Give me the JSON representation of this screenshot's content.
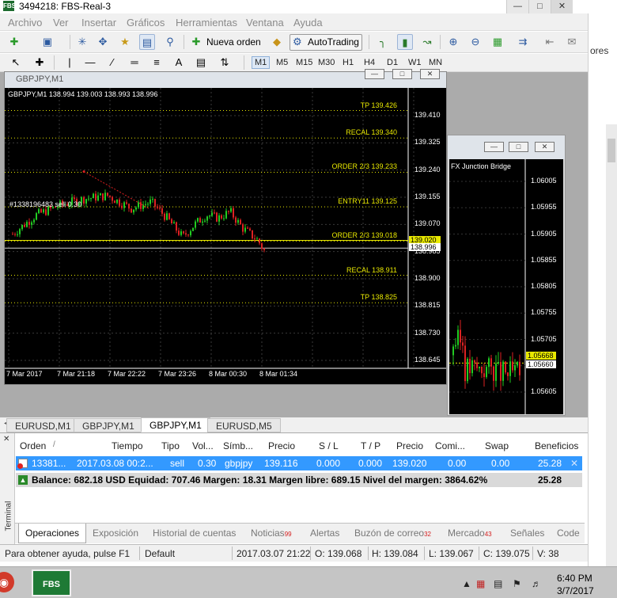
{
  "window": {
    "title": "3494218: FBS-Real-3",
    "app_icon": "FBS"
  },
  "menu": [
    "Archivo",
    "Ver",
    "Insertar",
    "Gráficos",
    "Herramientas",
    "Ventana",
    "Ayuda"
  ],
  "toolbar": {
    "new_order_label": "Nueva orden",
    "autotrading_label": "AutoTrading"
  },
  "timeframes": [
    "M1",
    "M5",
    "M15",
    "M30",
    "H1",
    "H4",
    "D1",
    "W1",
    "MN"
  ],
  "active_timeframe": "M1",
  "chart_main": {
    "window_title": "GBPJPY,M1",
    "header": "GBPJPY,M1  138.994 139.003 138.993 138.996",
    "price_ticks": [
      "139.410",
      "139.325",
      "139.240",
      "139.155",
      "139.070",
      "138.985",
      "138.900",
      "138.815",
      "138.730",
      "138.645"
    ],
    "time_ticks": [
      "7 Mar 2017",
      "7 Mar 21:18",
      "7 Mar 22:22",
      "7 Mar 23:26",
      "8 Mar 00:30",
      "8 Mar 01:34"
    ],
    "current_price": "138.996",
    "entry_marker": "139.020",
    "order_label": "#1338196483 sell 0.30",
    "levels": [
      {
        "label": "TP",
        "price": "139.426"
      },
      {
        "label": "RECAL",
        "price": "139.340"
      },
      {
        "label": "ORDER 2/3",
        "price": "139.233"
      },
      {
        "label": "ENTRY11",
        "price": "139.125"
      },
      {
        "label": "ORDER 2/3",
        "price": "139.018"
      },
      {
        "label": "RECAL",
        "price": "138.911"
      },
      {
        "label": "TP",
        "price": "138.825"
      }
    ]
  },
  "chart_second": {
    "label": "FX Junction Bridge",
    "price_ticks": [
      "1.06005",
      "1.05955",
      "1.05905",
      "1.05855",
      "1.05805",
      "1.05755",
      "1.05705",
      "1.05655",
      "1.05605"
    ],
    "current_price": "1.05660",
    "marker": "1.05668"
  },
  "right_strip": {
    "text": "ores"
  },
  "chart_tabs": [
    "EURUSD,M1",
    "GBPJPY,M1",
    "GBPJPY,M1",
    "EURUSD,M5"
  ],
  "active_chart_tab": 2,
  "terminal": {
    "side_label": "Terminal",
    "columns": [
      "Orden",
      "Tiempo",
      "Tipo",
      "Vol...",
      "Símb...",
      "Precio",
      "S / L",
      "T / P",
      "Precio",
      "Comi...",
      "Swap",
      "Beneficios"
    ],
    "order_row": [
      "13381...",
      "2017.03.08 00:2...",
      "sell",
      "0.30",
      "gbpjpy",
      "139.116",
      "0.000",
      "0.000",
      "139.020",
      "0.00",
      "0.00",
      "25.28"
    ],
    "balance_row": "Balance: 682.18 USD  Equidad: 707.46  Margen: 18.31  Margen libre: 689.15  Nivel del margen: 3864.62%",
    "balance_profit": "25.28",
    "tabs": [
      {
        "label": "Operaciones",
        "badge": ""
      },
      {
        "label": "Exposición",
        "badge": ""
      },
      {
        "label": "Historial de cuentas",
        "badge": ""
      },
      {
        "label": "Noticias",
        "badge": "99"
      },
      {
        "label": "Alertas",
        "badge": ""
      },
      {
        "label": "Buzón de correo",
        "badge": "32"
      },
      {
        "label": "Mercado",
        "badge": "43"
      },
      {
        "label": "Señales",
        "badge": ""
      },
      {
        "label": "Code",
        "badge": ""
      }
    ]
  },
  "statusbar": {
    "help": "Para obtener ayuda, pulse F1",
    "profile": "Default",
    "datetime": "2017.03.07 21:22",
    "open": "O: 139.068",
    "high": "H: 139.084",
    "low": "L: 139.067",
    "close": "C: 139.075",
    "volume": "V: 38"
  },
  "taskbar": {
    "app_label": "FBS",
    "time": "6:40 PM",
    "date": "3/7/2017"
  },
  "colors": {
    "chart_bg": "#000000",
    "level_yellow": "#e8e800",
    "bull": "#22cc22",
    "bear": "#dd2222",
    "selected_row": "#3399ff"
  }
}
